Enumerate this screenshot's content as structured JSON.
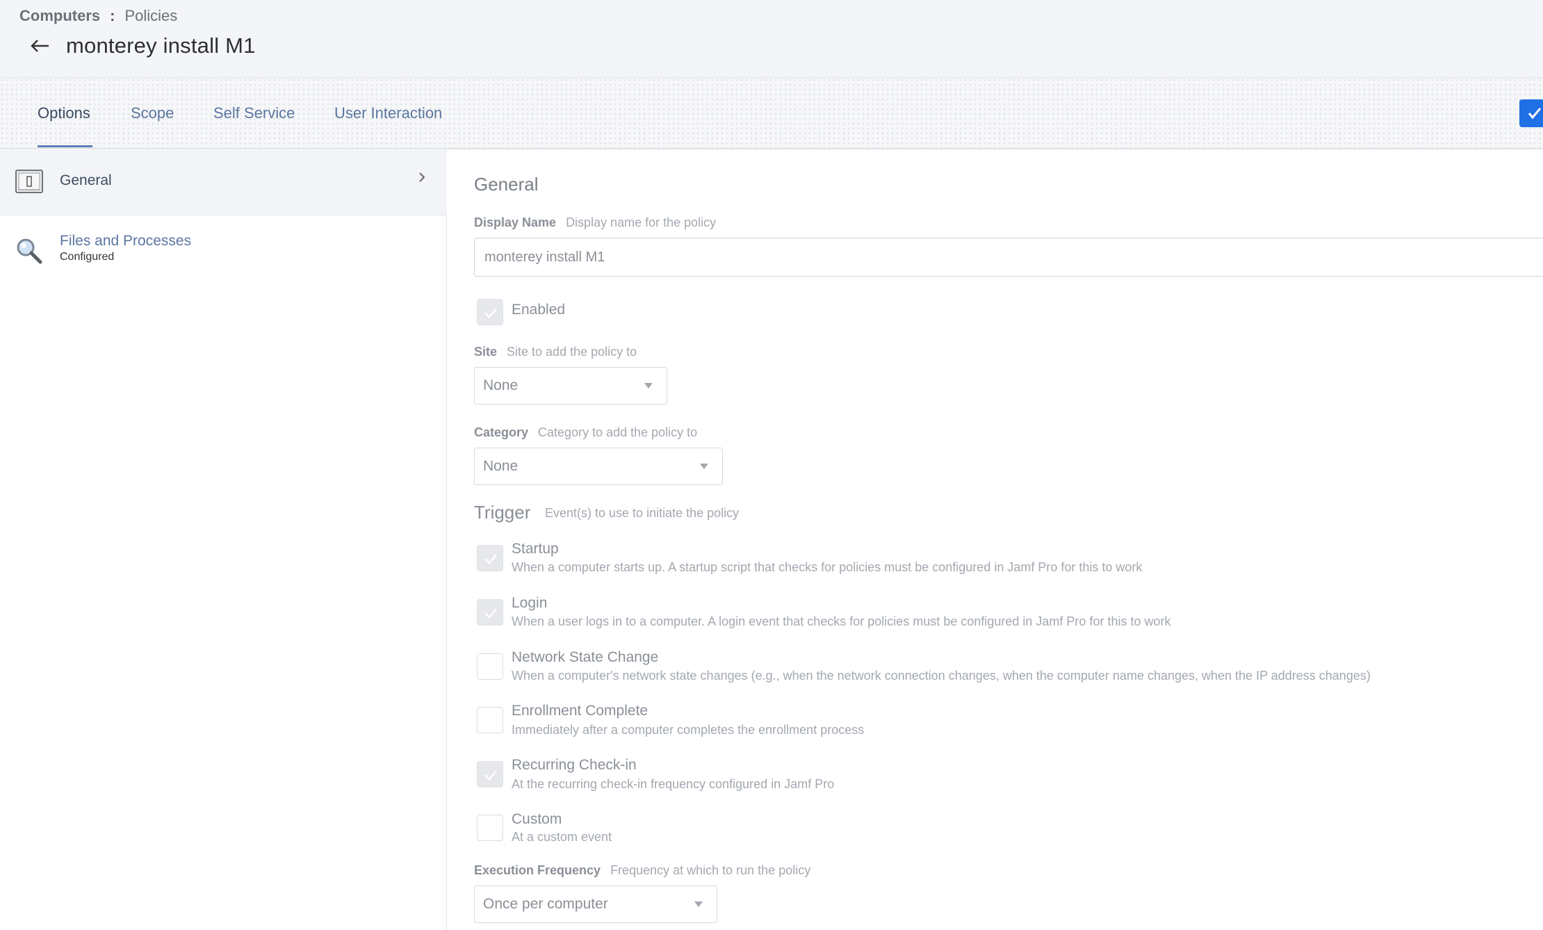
{
  "breadcrumb": {
    "section": "Computers",
    "separator": ":",
    "page": "Policies"
  },
  "header": {
    "title": "monterey install M1"
  },
  "tabs": [
    {
      "label": "Options",
      "active": true
    },
    {
      "label": "Scope",
      "active": false
    },
    {
      "label": "Self Service",
      "active": false
    },
    {
      "label": "User Interaction",
      "active": false
    }
  ],
  "sidebar": {
    "items": [
      {
        "label": "General",
        "status": "",
        "icon": "general-payload-icon",
        "selected": true
      },
      {
        "label": "Files and Processes",
        "status": "Configured",
        "icon": "magnifier-icon",
        "selected": false
      }
    ]
  },
  "general": {
    "section_title": "General",
    "display_name": {
      "label": "Display Name",
      "hint": "Display name for the policy",
      "value": "monterey install M1"
    },
    "enabled": {
      "label": "Enabled",
      "checked": true
    },
    "site": {
      "label": "Site",
      "hint": "Site to add the policy to",
      "value": "None"
    },
    "category": {
      "label": "Category",
      "hint": "Category to add the policy to",
      "value": "None"
    },
    "trigger": {
      "title": "Trigger",
      "hint": "Event(s) to use to initiate the policy",
      "options": [
        {
          "label": "Startup",
          "desc": "When a computer starts up. A startup script that checks for policies must be configured in Jamf Pro for this to work",
          "checked": true
        },
        {
          "label": "Login",
          "desc": "When a user logs in to a computer. A login event that checks for policies must be configured in Jamf Pro for this to work",
          "checked": true
        },
        {
          "label": "Network State Change",
          "desc": "When a computer's network state changes (e.g., when the network connection changes, when the computer name changes, when the IP address changes)",
          "checked": false
        },
        {
          "label": "Enrollment Complete",
          "desc": "Immediately after a computer completes the enrollment process",
          "checked": false
        },
        {
          "label": "Recurring Check-in",
          "desc": "At the recurring check-in frequency configured in Jamf Pro",
          "checked": true
        },
        {
          "label": "Custom",
          "desc": "At a custom event",
          "checked": false
        }
      ]
    },
    "execution_frequency": {
      "label": "Execution Frequency",
      "hint": "Frequency at which to run the policy",
      "value": "Once per computer"
    }
  },
  "colors": {
    "accent": "#1f6fe5",
    "tab_link": "#5a76a0",
    "header_bg": "#f4f5f8"
  }
}
